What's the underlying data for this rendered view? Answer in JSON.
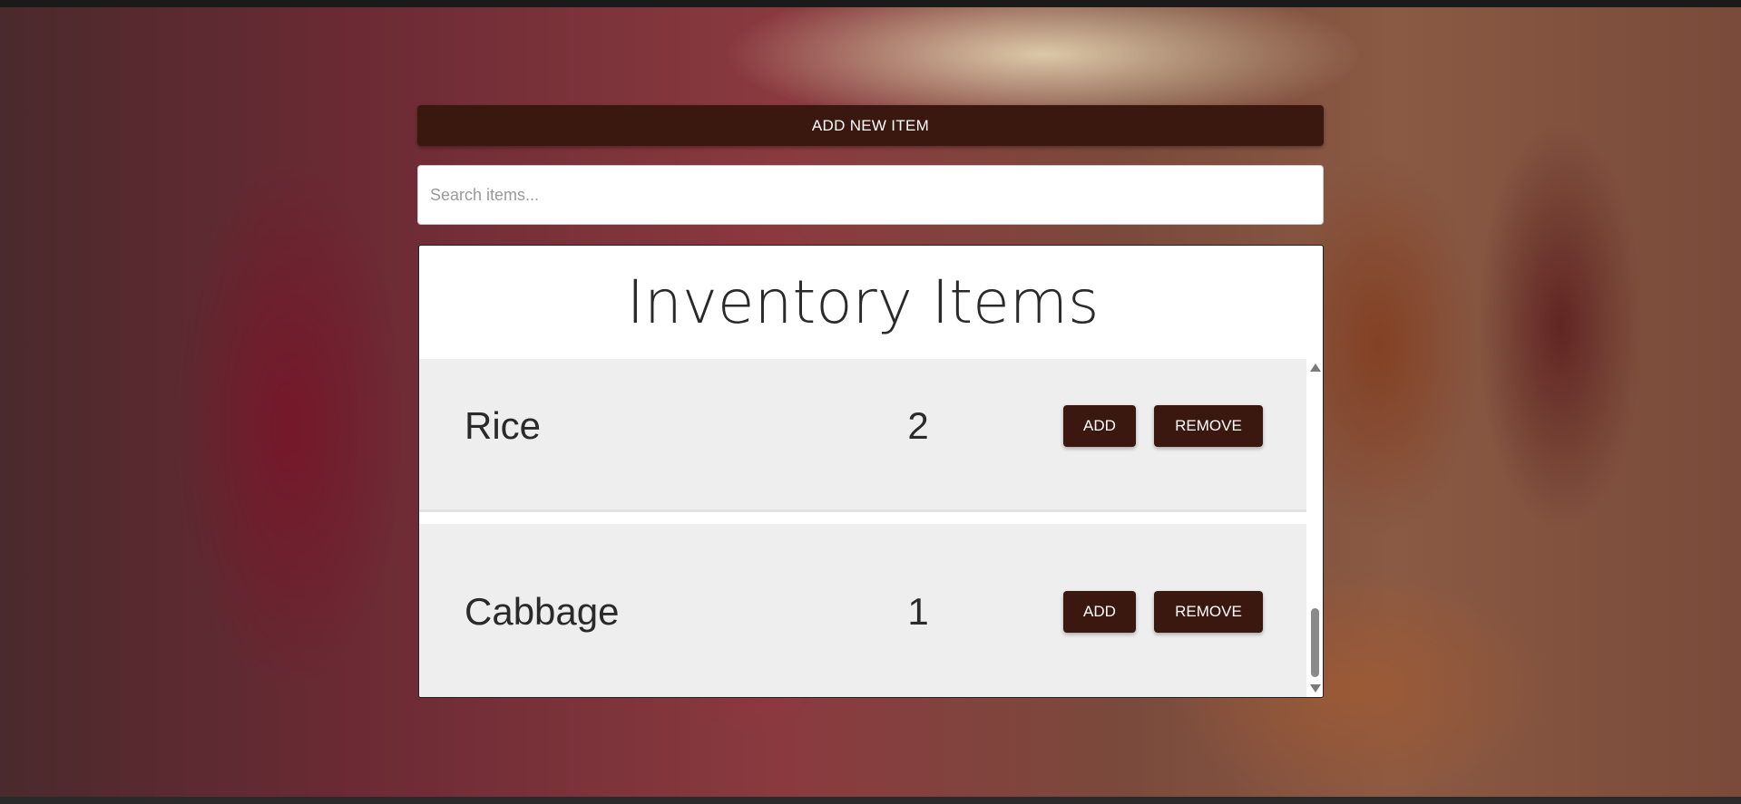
{
  "toolbar": {
    "add_new_label": "ADD NEW ITEM"
  },
  "search": {
    "placeholder": "Search items...",
    "value": ""
  },
  "inventory": {
    "title": "Inventory Items",
    "items": [
      {
        "name": "Rice",
        "quantity": "2",
        "add_label": "ADD",
        "remove_label": "REMOVE"
      },
      {
        "name": "Cabbage",
        "quantity": "1",
        "add_label": "ADD",
        "remove_label": "REMOVE"
      }
    ]
  },
  "colors": {
    "button_bg": "#3a1810",
    "row_bg": "#eeeeee",
    "panel_bg": "#ffffff"
  },
  "icons": {
    "scroll_up": "triangle-up-icon",
    "scroll_down": "triangle-down-icon"
  },
  "list_scroll_position": 0.85
}
